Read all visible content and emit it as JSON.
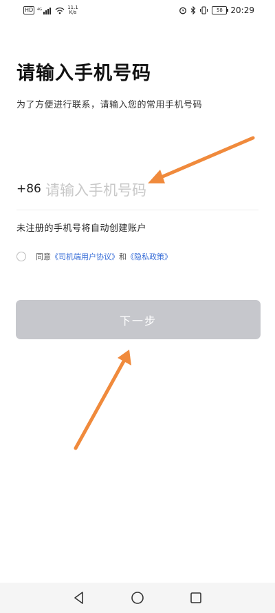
{
  "status_bar": {
    "hd": "HD",
    "net_type": "4G",
    "speed_value": "11.1",
    "speed_unit": "K/s",
    "battery": "58",
    "time": "20:29"
  },
  "page": {
    "title": "请输入手机号码",
    "subtitle": "为了方便进行联系，请输入您的常用手机号码"
  },
  "phone": {
    "country_code": "+86",
    "value": "",
    "placeholder": "请输入手机号码"
  },
  "note": "未注册的手机号将自动创建账户",
  "agreement": {
    "prefix": "同意",
    "user_agreement": "《司机端用户协议》",
    "and": "和",
    "privacy_policy": "《隐私政策》"
  },
  "next_button": {
    "label": "下一步",
    "color": "#c6c7cc"
  },
  "annotation": {
    "arrow_color": "#f08a3c"
  },
  "nav_bar": {
    "icons": [
      "back-icon",
      "home-icon",
      "recents-icon"
    ]
  }
}
